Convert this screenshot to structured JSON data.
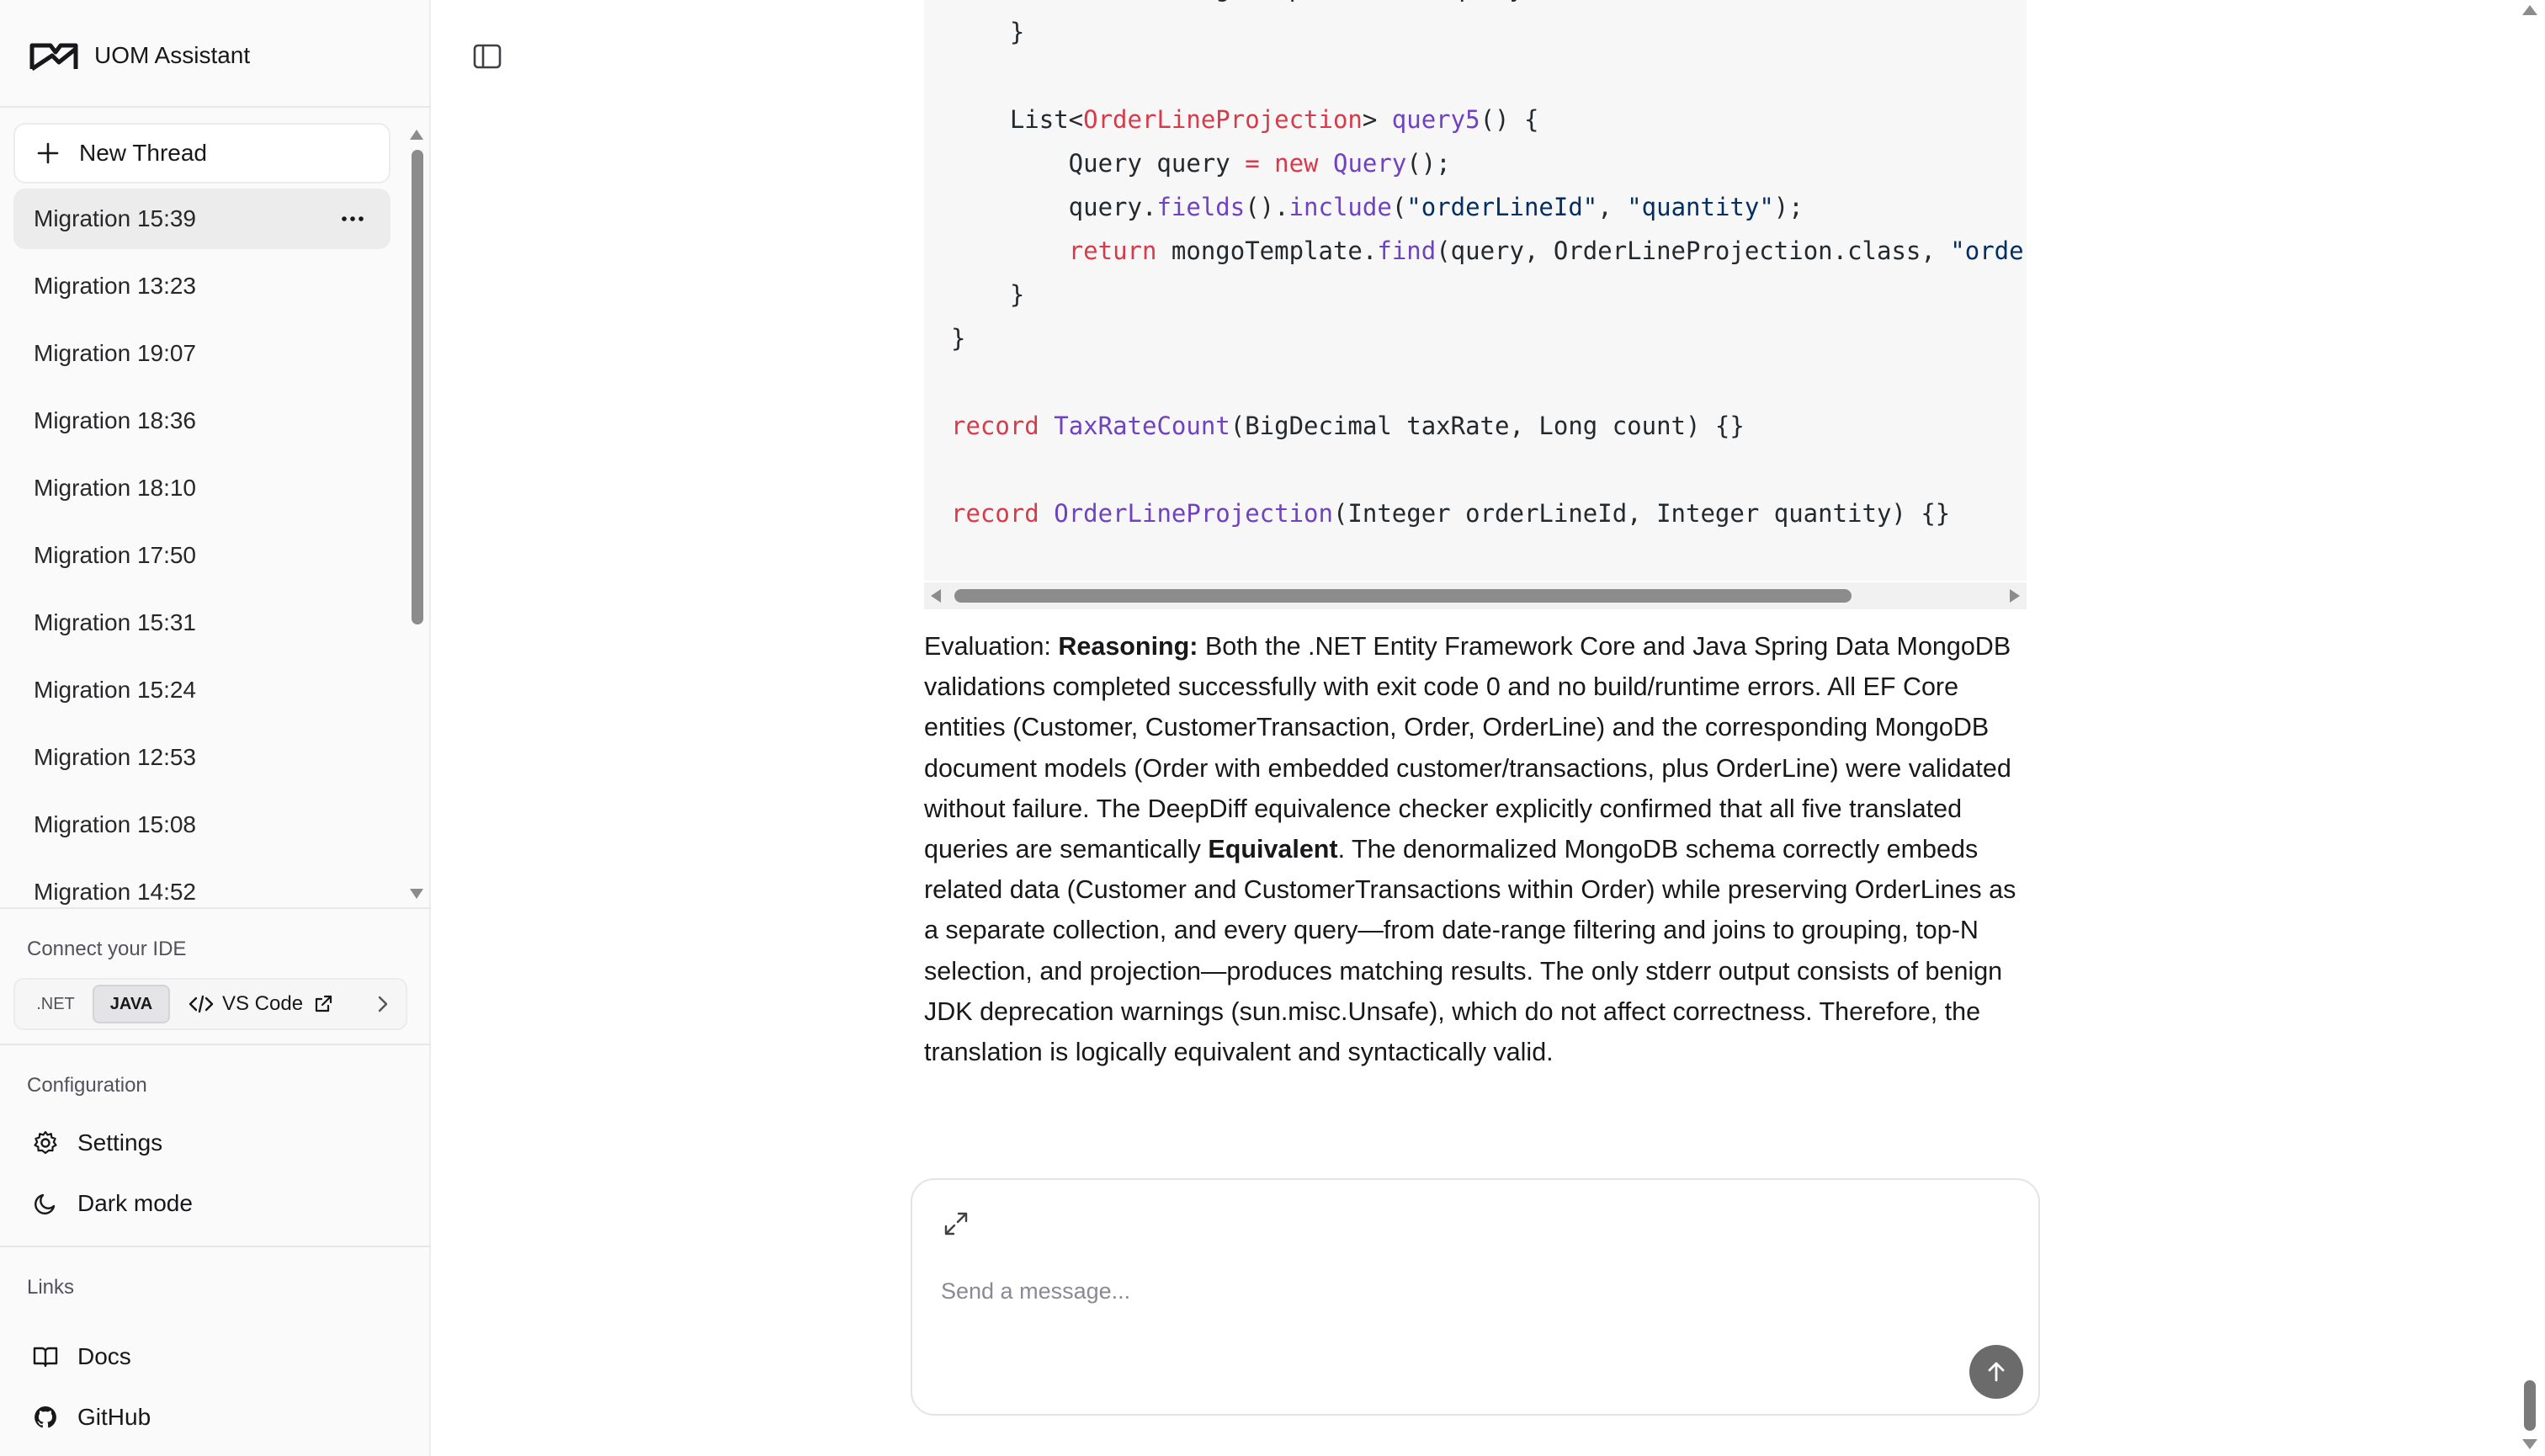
{
  "app": {
    "title": "UOM Assistant"
  },
  "sidebar": {
    "new_thread_label": "New Thread",
    "threads": [
      {
        "label": "Migration 15:39",
        "active": true
      },
      {
        "label": "Migration 13:23"
      },
      {
        "label": "Migration 19:07"
      },
      {
        "label": "Migration 18:36"
      },
      {
        "label": "Migration 18:10"
      },
      {
        "label": "Migration 17:50"
      },
      {
        "label": "Migration 15:31"
      },
      {
        "label": "Migration 15:24"
      },
      {
        "label": "Migration 12:53"
      },
      {
        "label": "Migration 15:08"
      },
      {
        "label": "Migration 14:52"
      }
    ],
    "ide": {
      "title": "Connect your IDE",
      "tabs": [
        ".NET",
        "JAVA"
      ],
      "selected": "JAVA",
      "vscode_label": "VS Code"
    },
    "configuration": {
      "title": "Configuration",
      "settings_label": "Settings",
      "dark_mode_label": "Dark mode"
    },
    "links": {
      "title": "Links",
      "docs_label": "Docs",
      "github_label": "GitHub"
    }
  },
  "code": {
    "lines": [
      [
        {
          "t": "        "
        },
        {
          "t": "return",
          "c": "kw"
        },
        {
          "t": " mongoTemplate."
        },
        {
          "t": "find",
          "c": "fn"
        },
        {
          "t": "(query, OrderLine.class);"
        }
      ],
      [
        {
          "t": "    }"
        }
      ],
      [
        {
          "t": ""
        }
      ],
      [
        {
          "t": "    List<"
        },
        {
          "t": "OrderLineProjection",
          "c": "kw"
        },
        {
          "t": "> "
        },
        {
          "t": "query5",
          "c": "fn"
        },
        {
          "t": "() {"
        }
      ],
      [
        {
          "t": "        Query query "
        },
        {
          "t": "=",
          "c": "kw"
        },
        {
          "t": " "
        },
        {
          "t": "new",
          "c": "kw"
        },
        {
          "t": " "
        },
        {
          "t": "Query",
          "c": "fn"
        },
        {
          "t": "();"
        }
      ],
      [
        {
          "t": "        query."
        },
        {
          "t": "fields",
          "c": "fn"
        },
        {
          "t": "()."
        },
        {
          "t": "include",
          "c": "fn"
        },
        {
          "t": "("
        },
        {
          "t": "\"orderLineId\"",
          "c": "str"
        },
        {
          "t": ", "
        },
        {
          "t": "\"quantity\"",
          "c": "str"
        },
        {
          "t": ");"
        }
      ],
      [
        {
          "t": "        "
        },
        {
          "t": "return",
          "c": "kw"
        },
        {
          "t": " mongoTemplate."
        },
        {
          "t": "find",
          "c": "fn"
        },
        {
          "t": "(query, OrderLineProjection.class, "
        },
        {
          "t": "\"orde",
          "c": "str"
        }
      ],
      [
        {
          "t": "    }"
        }
      ],
      [
        {
          "t": "}"
        }
      ],
      [
        {
          "t": ""
        }
      ],
      [
        {
          "t": "record",
          "c": "kw"
        },
        {
          "t": " "
        },
        {
          "t": "TaxRateCount",
          "c": "fn"
        },
        {
          "t": "(BigDecimal taxRate, Long count) {}"
        }
      ],
      [
        {
          "t": ""
        }
      ],
      [
        {
          "t": "record",
          "c": "kw"
        },
        {
          "t": " "
        },
        {
          "t": "OrderLineProjection",
          "c": "fn"
        },
        {
          "t": "(Integer orderLineId, Integer quantity) {}"
        }
      ]
    ]
  },
  "evaluation": {
    "prefix": "Evaluation: ",
    "reasoning_label": "Reasoning:",
    "text_1": " Both the .NET Entity Framework Core and Java Spring Data MongoDB validations completed successfully with exit code 0 and no build/runtime errors. All EF Core entities (Customer, CustomerTransaction, Order, OrderLine) and the corresponding MongoDB document models (Order with embedded customer/transactions, plus OrderLine) were validated without failure. The DeepDiff equivalence checker explicitly confirmed that all five translated queries are semantically ",
    "equivalent_label": "Equivalent",
    "text_2": ". The denormalized MongoDB schema correctly embeds related data (Customer and CustomerTransactions within Order) while preserving OrderLines as a separate collection, and every query—from date-range filtering and joins to grouping, top-N selection, and projection—produces matching results. The only stderr output consists of benign JDK deprecation warnings (sun.misc.Unsafe), which do not affect correctness. Therefore, the translation is logically equivalent and syntactically valid."
  },
  "composer": {
    "placeholder": "Send a message..."
  }
}
